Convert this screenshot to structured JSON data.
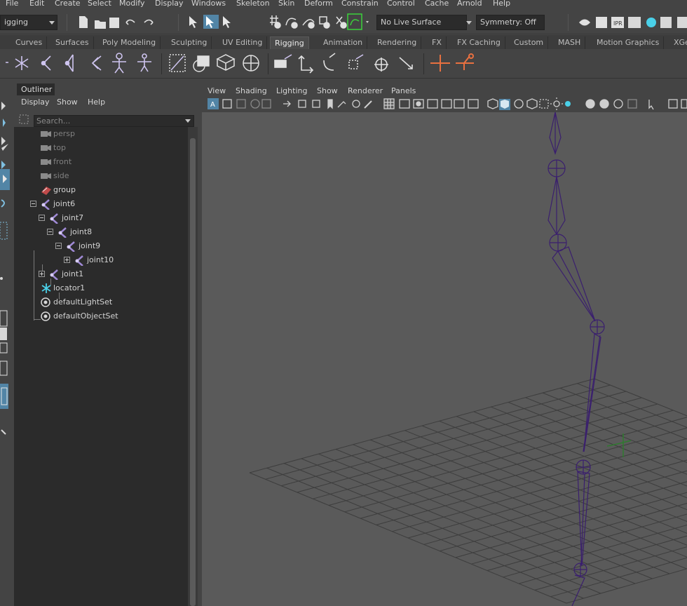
{
  "menubar": {
    "items": [
      "File",
      "Edit",
      "Create",
      "Select",
      "Modify",
      "Display",
      "Windows",
      "Skeleton",
      "Skin",
      "Deform",
      "Constrain",
      "Control",
      "Cache",
      "Arnold",
      "Help"
    ]
  },
  "statusline": {
    "menuset": "igging",
    "live_surface": "No Live Surface",
    "symmetry": "Symmetry: Off"
  },
  "shelf": {
    "tabs": [
      "Curves",
      "Surfaces",
      "Poly Modeling",
      "Sculpting",
      "UV Editing",
      "Rigging",
      "Animation",
      "Rendering",
      "FX",
      "FX Caching",
      "Custom",
      "MASH",
      "Motion Graphics",
      "XGe"
    ],
    "active_tab": "Rigging"
  },
  "outliner": {
    "title": "Outliner",
    "menu": [
      "Display",
      "Show",
      "Help"
    ],
    "search_placeholder": "Search...",
    "items": [
      {
        "label": "persp",
        "icon": "camera-icon",
        "depth": 0,
        "dim": true
      },
      {
        "label": "top",
        "icon": "camera-icon",
        "depth": 0,
        "dim": true
      },
      {
        "label": "front",
        "icon": "camera-icon",
        "depth": 0,
        "dim": true
      },
      {
        "label": "side",
        "icon": "camera-icon",
        "depth": 0,
        "dim": true
      },
      {
        "label": "group",
        "icon": "group-icon",
        "depth": 0,
        "dim": false
      },
      {
        "label": "joint6",
        "icon": "joint-icon",
        "depth": 0,
        "dim": false,
        "expander": "minus"
      },
      {
        "label": "joint7",
        "icon": "joint-icon",
        "depth": 1,
        "dim": false,
        "expander": "minus"
      },
      {
        "label": "joint8",
        "icon": "joint-icon",
        "depth": 2,
        "dim": false,
        "expander": "minus"
      },
      {
        "label": "joint9",
        "icon": "joint-icon",
        "depth": 3,
        "dim": false,
        "expander": "minus"
      },
      {
        "label": "joint10",
        "icon": "joint-icon",
        "depth": 4,
        "dim": false,
        "expander": "plus"
      },
      {
        "label": "joint1",
        "icon": "joint-icon",
        "depth": 1,
        "dim": false,
        "expander": "plus"
      },
      {
        "label": "locator1",
        "icon": "locator-icon",
        "depth": 0,
        "dim": false
      },
      {
        "label": "defaultLightSet",
        "icon": "set-icon",
        "depth": 0,
        "dim": false
      },
      {
        "label": "defaultObjectSet",
        "icon": "set-icon",
        "depth": 0,
        "dim": false
      }
    ]
  },
  "panel": {
    "menu": [
      "View",
      "Shading",
      "Lighting",
      "Show",
      "Renderer",
      "Panels"
    ]
  },
  "colors": {
    "accent_blue": "#5285a6",
    "joint_purple": "#3a1f6e",
    "joint_icon": "#a08ad6",
    "locator_icon": "#4ad0e8",
    "grid_line": "#3d3d3d",
    "viewport_bg": "#5a5a5a"
  }
}
